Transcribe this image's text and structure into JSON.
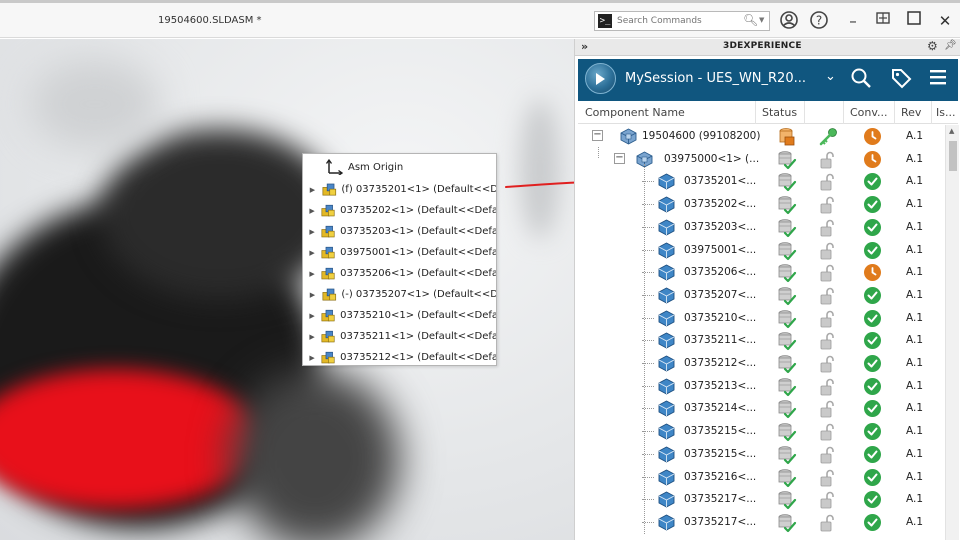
{
  "window": {
    "title": "19504600.SLDASM *",
    "search_placeholder": "Search Commands"
  },
  "tree_popup": {
    "origin_label": "Asm Origin",
    "items": [
      "(f) 03735201<1> (Default<<D",
      "03735202<1> (Default<<Defa",
      "03735203<1> (Default<<Defa",
      "03975001<1> (Default<<Defa",
      "03735206<1> (Default<<Defa",
      "(-) 03735207<1> (Default<<D",
      "03735210<1> (Default<<Defa",
      "03735211<1> (Default<<Defa",
      "03735212<1> (Default<<Defa"
    ]
  },
  "panel": {
    "header_title": "3DEXPERIENCE",
    "session_name": "MySession - UES_WN_R20...",
    "columns": {
      "name": "Component Name",
      "status": "Status",
      "conv": "Conv...",
      "rev": "Rev",
      "is": "Is..."
    },
    "rows": [
      {
        "name": "19504600 (99108200)",
        "rev": "A.1",
        "level": 0,
        "status": "orange",
        "lock": "key",
        "conv": "wait",
        "toggle": "−"
      },
      {
        "name": "03975000<1> (...",
        "rev": "A.1",
        "level": 1,
        "status": "ok",
        "lock": "open",
        "conv": "wait",
        "toggle": "−"
      },
      {
        "name": "03735201<...",
        "rev": "A.1",
        "level": 2,
        "status": "ok",
        "lock": "open",
        "conv": "ok"
      },
      {
        "name": "03735202<...",
        "rev": "A.1",
        "level": 2,
        "status": "ok",
        "lock": "open",
        "conv": "ok"
      },
      {
        "name": "03735203<...",
        "rev": "A.1",
        "level": 2,
        "status": "ok",
        "lock": "open",
        "conv": "ok"
      },
      {
        "name": "03975001<...",
        "rev": "A.1",
        "level": 2,
        "status": "ok",
        "lock": "open",
        "conv": "ok"
      },
      {
        "name": "03735206<...",
        "rev": "A.1",
        "level": 2,
        "status": "ok",
        "lock": "open",
        "conv": "wait"
      },
      {
        "name": "03735207<...",
        "rev": "A.1",
        "level": 2,
        "status": "ok",
        "lock": "open",
        "conv": "ok"
      },
      {
        "name": "03735210<...",
        "rev": "A.1",
        "level": 2,
        "status": "ok",
        "lock": "open",
        "conv": "ok"
      },
      {
        "name": "03735211<...",
        "rev": "A.1",
        "level": 2,
        "status": "ok",
        "lock": "open",
        "conv": "ok"
      },
      {
        "name": "03735212<...",
        "rev": "A.1",
        "level": 2,
        "status": "ok",
        "lock": "open",
        "conv": "ok"
      },
      {
        "name": "03735213<...",
        "rev": "A.1",
        "level": 2,
        "status": "ok",
        "lock": "open",
        "conv": "ok"
      },
      {
        "name": "03735214<...",
        "rev": "A.1",
        "level": 2,
        "status": "ok",
        "lock": "open",
        "conv": "ok"
      },
      {
        "name": "03735215<...",
        "rev": "A.1",
        "level": 2,
        "status": "ok",
        "lock": "open",
        "conv": "ok"
      },
      {
        "name": "03735215<...",
        "rev": "A.1",
        "level": 2,
        "status": "ok",
        "lock": "open",
        "conv": "ok"
      },
      {
        "name": "03735216<...",
        "rev": "A.1",
        "level": 2,
        "status": "ok",
        "lock": "open",
        "conv": "ok"
      },
      {
        "name": "03735217<...",
        "rev": "A.1",
        "level": 2,
        "status": "ok",
        "lock": "open",
        "conv": "ok"
      },
      {
        "name": "03735217<...",
        "rev": "A.1",
        "level": 2,
        "status": "ok",
        "lock": "open",
        "conv": "ok"
      }
    ]
  },
  "colors": {
    "session_bar": "#10567f",
    "conv_ok": "#2fa64a",
    "conv_wait": "#e07b1c",
    "annotation_arrow": "#e02020"
  },
  "icons": {
    "command_prompt": "command-prompt-icon",
    "search": "search-icon",
    "user": "user-icon",
    "help": "help-icon",
    "minimize": "minimize-icon",
    "restore": "restore-icon",
    "maximize": "maximize-icon",
    "close": "close-icon",
    "origin": "origin-axis-icon",
    "part": "part-icon",
    "assembly": "assembly-icon",
    "status_ok": "database-check-icon",
    "lock_open": "unlocked-icon",
    "key": "key-icon",
    "conv_ok": "check-circle-icon",
    "conv_wait": "clock-icon"
  }
}
